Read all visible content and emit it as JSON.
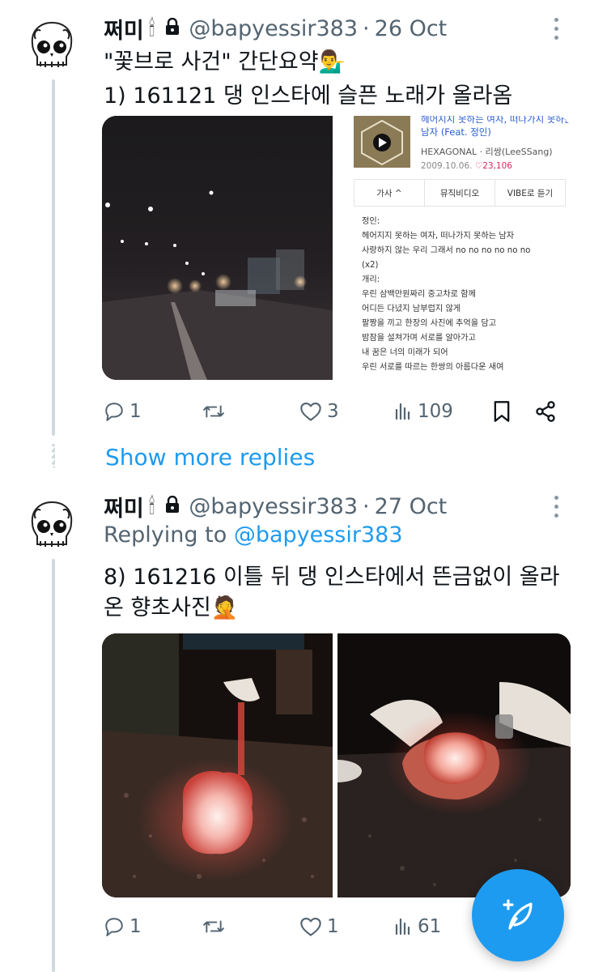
{
  "tweets": [
    {
      "display_name": "쩌미",
      "candle": "🕯",
      "handle": "@bapyessir383",
      "separator": "·",
      "date": "26 Oct",
      "text_line1": "\"꽃브로 사건\" 간단요약💁‍♂️",
      "text_line2": "1) 161121 댕 인스타에 슬픈 노래가 올라옴",
      "actions": {
        "replies": "1",
        "retweets": "",
        "likes": "3",
        "views": "109"
      }
    },
    {
      "display_name": "쩌미",
      "candle": "🕯",
      "handle": "@bapyessir383",
      "separator": "·",
      "date": "27 Oct",
      "replying_prefix": "Replying to",
      "replying_handle": "@bapyessir383",
      "text_line1": "8) 161216 이틀 뒤 댕 인스타에서 뜬금없이 올라",
      "text_line2": "온 향초사진🤦",
      "actions": {
        "replies": "1",
        "retweets": "",
        "likes": "1",
        "views": "61"
      }
    }
  ],
  "show_more_replies": "Show more replies",
  "lyrics_card": {
    "title": "헤어지지 못하는 여자, 떠나가지 못하는 남자 (Feat. 정인)",
    "artist": "HEXAGONAL · 리쌍(LeeSSang)",
    "date": "2009.10.06.",
    "likes": "♡23,106",
    "tabs": [
      "가사 ^",
      "뮤직비디오",
      "VIBE로 듣기"
    ],
    "lines": [
      "정인:",
      "헤어지지 못하는 여자, 떠나가지 못하는 남자",
      "사랑하지 않는 우리 그래서 no no no no no no",
      "(x2)",
      "개리:",
      "우린 삼백만원짜리 중고차로 함께",
      "어디든 다녔지 남부럽지 않게",
      "팔짱을 끼고 한장의 사진에 추억을 담고",
      "밤잠을 설쳐가며 서로를 알아가고",
      "내 꿈은 너의 미래가 되어",
      "우린 서로를 따르는 한쌍의 아름다운 새여"
    ]
  },
  "icons": {
    "reply": "reply-icon",
    "retweet": "retweet-icon",
    "like": "heart-icon",
    "views": "views-icon",
    "bookmark": "bookmark-icon",
    "share": "share-icon",
    "compose": "compose-icon"
  },
  "colors": {
    "accent": "#1d9bf0",
    "muted": "#536471",
    "text": "#0f1419"
  }
}
